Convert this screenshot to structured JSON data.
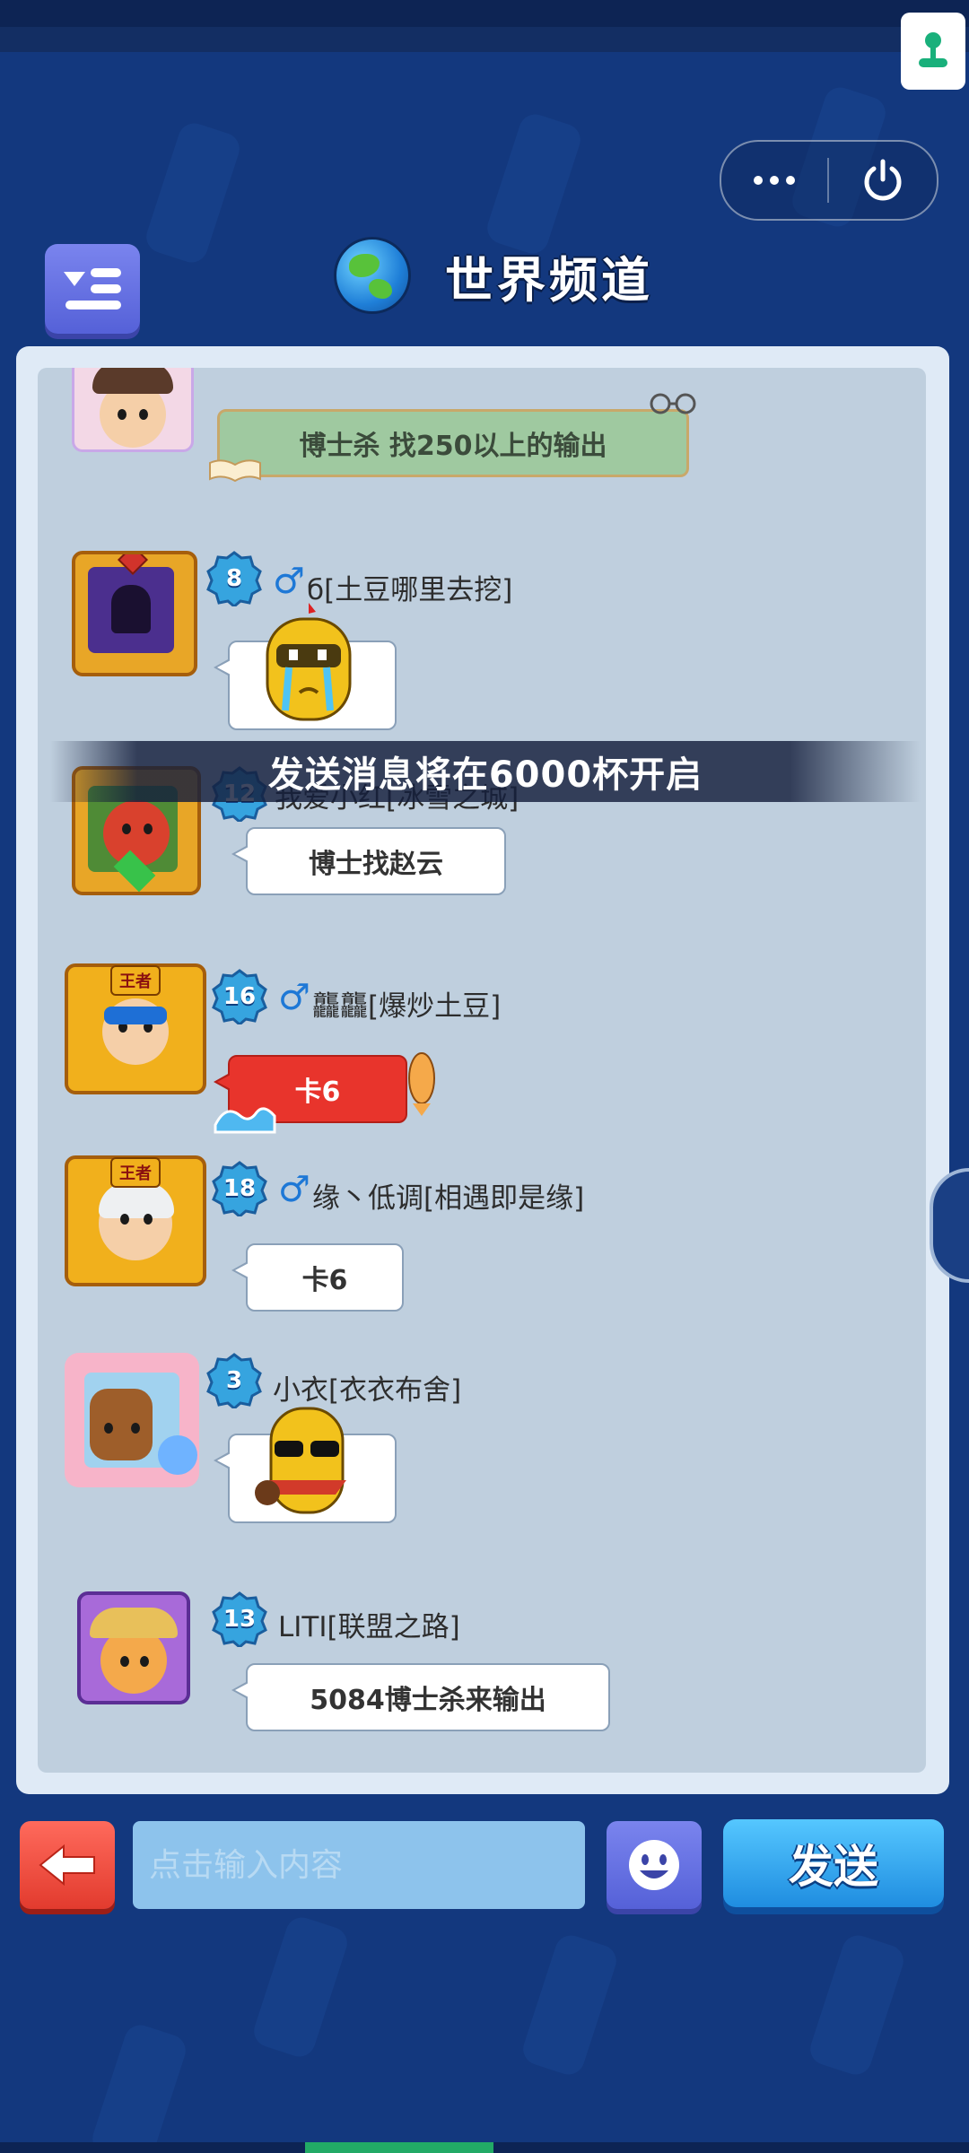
{
  "header": {
    "title": "世界频道"
  },
  "messages": [
    {
      "level": "",
      "name": "",
      "text": "博士杀 找250以上的输出",
      "style": "green-scroll"
    },
    {
      "level": "8",
      "gender": "♂",
      "name": "б[土豆哪里去挖]",
      "text": "",
      "style": "sticker-knight-crying"
    },
    {
      "level": "12",
      "gender": "",
      "name": "我爱小红[冰雪之城]",
      "text": "博士找赵云",
      "style": "white"
    },
    {
      "level": "16",
      "gender": "♂",
      "name": "龘龘[爆炒土豆]",
      "text": "卡6",
      "style": "red",
      "badge": "王者"
    },
    {
      "level": "18",
      "gender": "♂",
      "name": "缘丶低调[相遇即是缘]",
      "text": "卡6",
      "style": "white",
      "badge": "王者"
    },
    {
      "level": "3",
      "gender": "",
      "name": "小衣[衣衣布舍]",
      "text": "",
      "style": "sticker-sunglasses"
    },
    {
      "level": "13",
      "gender": "",
      "name": "LITI[联盟之路]",
      "text": "5084博士杀来输出",
      "style": "white"
    }
  ],
  "toast": {
    "text": "发送消息将在6000杯开启"
  },
  "composer": {
    "placeholder": "点击输入内容",
    "send_label": "发送"
  },
  "colors": {
    "background": "#13387e",
    "panel": "#dfeaf6",
    "chat_area": "#bfcfde",
    "send": "#2a9ce8",
    "back": "#e8442f",
    "emoji": "#5e6ae0"
  }
}
